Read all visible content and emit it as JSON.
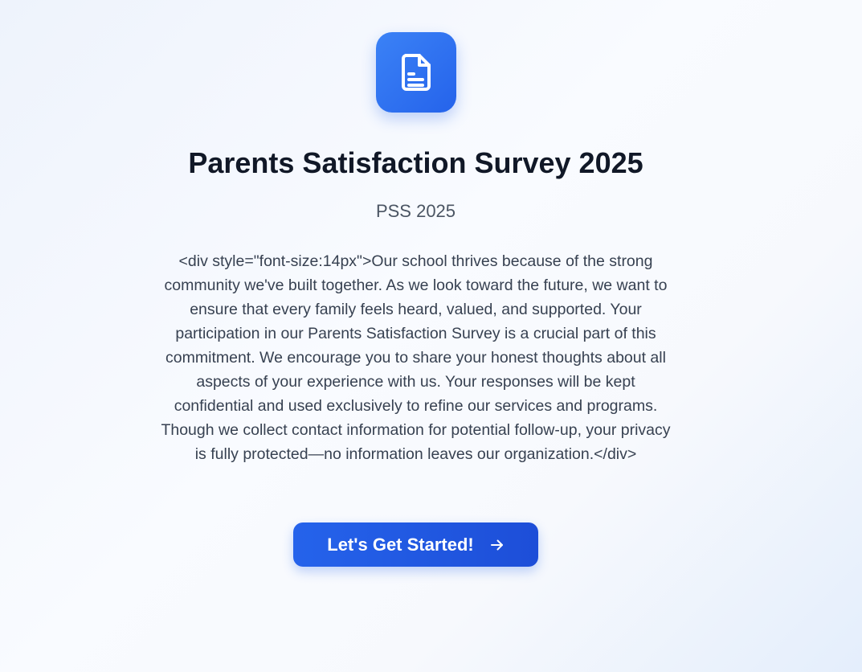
{
  "header": {
    "icon": "document-icon",
    "accent_color": "#2563eb"
  },
  "survey": {
    "title": "Parents Satisfaction Survey 2025",
    "code": "PSS 2025",
    "description": "<div style=\"font-size:14px\">Our school thrives because of the strong community we've built together. As we look toward the future, we want to ensure that every family feels heard, valued, and supported. Your participation in our Parents Satisfaction Survey is a crucial part of this commitment. We encourage you to share your honest thoughts about all aspects of your experience with us. Your responses will be kept confidential and used exclusively to refine our services and programs. Though we collect contact information for potential follow-up, your privacy is fully protected—no information leaves our organization.</div>"
  },
  "actions": {
    "start_label": "Let's Get Started!",
    "start_icon": "arrow-right-icon"
  }
}
